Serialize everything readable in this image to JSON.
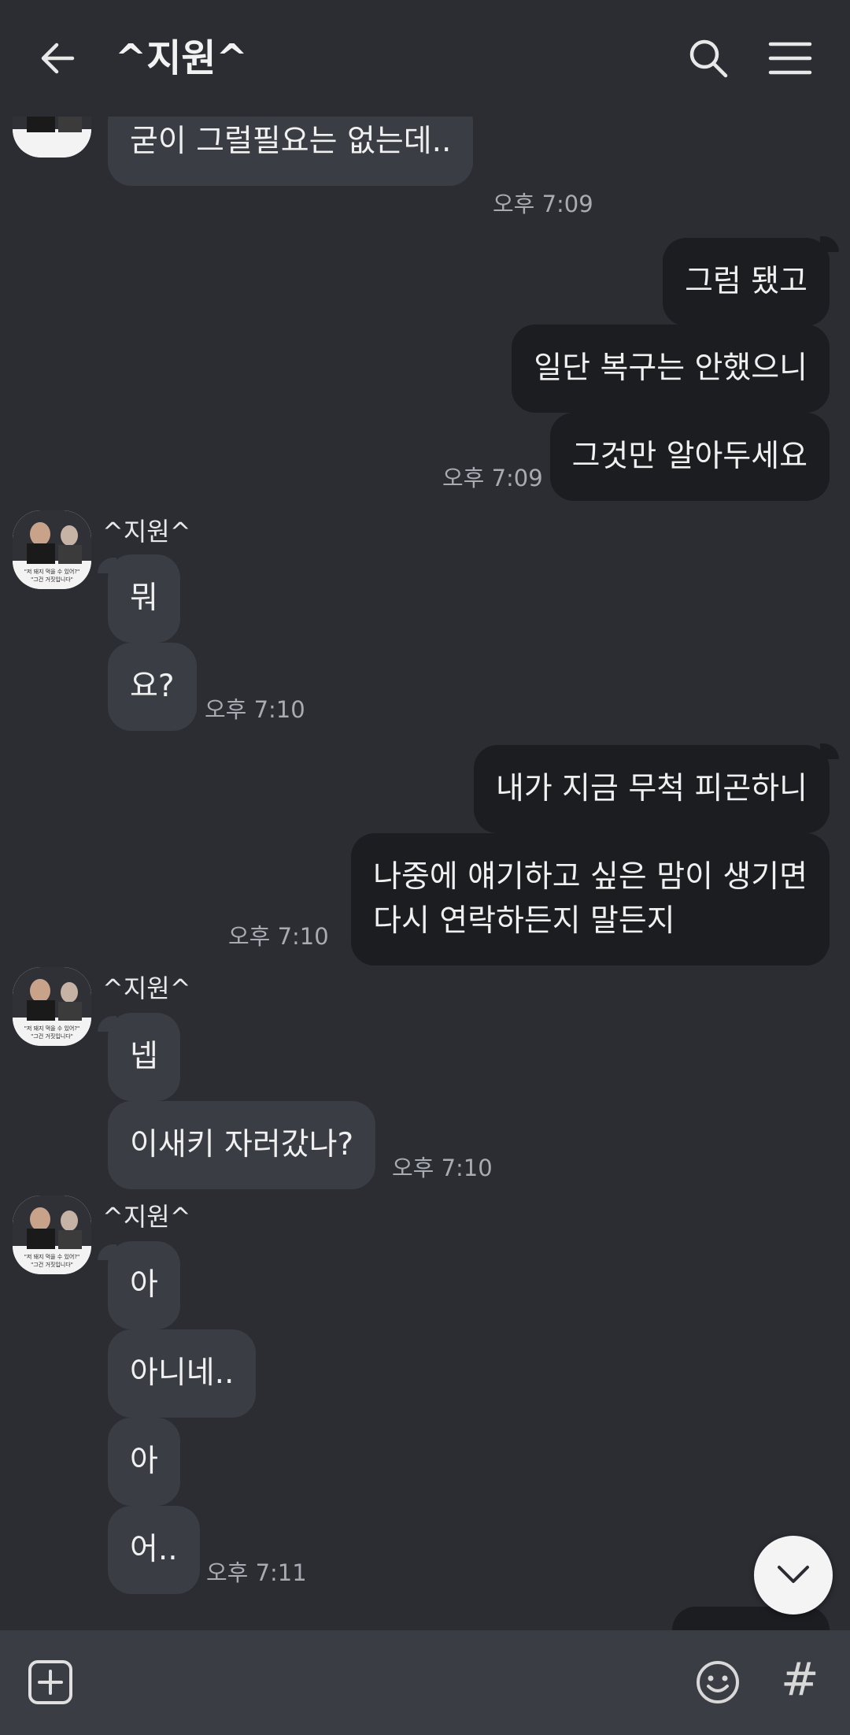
{
  "header": {
    "title": "^지원^"
  },
  "contact_name": "^지원^",
  "avatar_caption_line1": "\"저 돼지 먹을 수 있어?\"",
  "avatar_caption_line2": "\"그건 거짓입니다\"",
  "messages": {
    "m1": {
      "text": "굳이 그럴필요는 없는데..",
      "time": "오후 7:09"
    },
    "m2": {
      "text": "그럼 됐고"
    },
    "m3": {
      "text": "일단 복구는 안했으니"
    },
    "m4": {
      "text": "그것만 알아두세요",
      "time": "오후 7:09"
    },
    "m5": {
      "text": "뭐"
    },
    "m6": {
      "text": "요?",
      "time": "오후 7:10"
    },
    "m7": {
      "text": "내가 지금 무척 피곤하니"
    },
    "m8": {
      "line1": "나중에 얘기하고 싶은 맘이 생기면",
      "line2": "다시 연락하든지 말든지",
      "time": "오후 7:10"
    },
    "m9": {
      "text": "넵"
    },
    "m10": {
      "text": "이새키 자러갔나?",
      "time": "오후 7:10"
    },
    "m11": {
      "text": "아"
    },
    "m12": {
      "text": "아니네.."
    },
    "m13": {
      "text": "아"
    },
    "m14": {
      "text": "어..",
      "time": "오후 7:11"
    }
  },
  "icons": {
    "back": "arrow-left-icon",
    "search": "search-icon",
    "menu": "hamburger-menu-icon",
    "scroll_down": "chevron-down-icon",
    "attach": "plus-square-icon",
    "emoji": "smiley-icon",
    "hashtag": "hashtag-icon"
  },
  "bottom_bar": {
    "hash_label": "#"
  },
  "colors": {
    "background": "#2b2d33",
    "incoming_bubble": "#3a3d44",
    "outgoing_bubble": "#1c1d21",
    "timestamp": "#a8abb2"
  }
}
